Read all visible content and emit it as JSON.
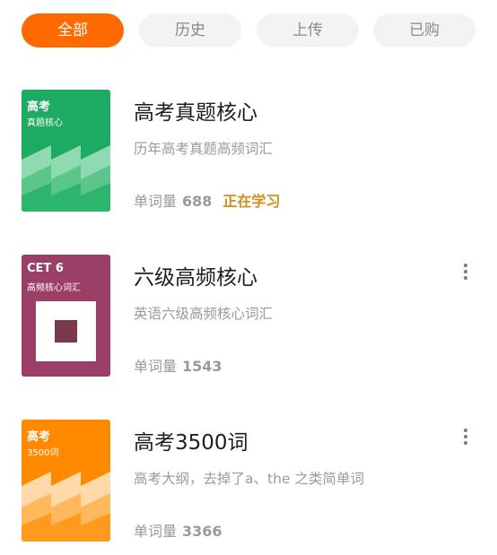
{
  "tabs": [
    {
      "label": "全部",
      "active": true
    },
    {
      "label": "历史",
      "active": false
    },
    {
      "label": "上传",
      "active": false
    },
    {
      "label": "已购",
      "active": false
    }
  ],
  "books": [
    {
      "cover_title": "高考",
      "cover_subtitle": "真题核心",
      "cover_color": "#1daa62",
      "title": "高考真题核心",
      "description": "历年高考真题高频词汇",
      "count_label": "单词量",
      "count": "688",
      "status": "正在学习",
      "has_more_menu": false
    },
    {
      "cover_title": "CET 6",
      "cover_subtitle": "高频核心词汇",
      "cover_color": "#9c3f66",
      "title": "六级高频核心",
      "description": "英语六级高频核心词汇",
      "count_label": "单词量",
      "count": "1543",
      "status": "",
      "has_more_menu": true
    },
    {
      "cover_title": "高考",
      "cover_subtitle": "3500词",
      "cover_color": "#ff8a00",
      "title": "高考3500词",
      "description": "高考大纲，去掉了a、the 之类简单词",
      "count_label": "单词量",
      "count": "3366",
      "status": "",
      "has_more_menu": true
    }
  ],
  "colors": {
    "accent": "#ff6a00",
    "status": "#d98a1a"
  }
}
